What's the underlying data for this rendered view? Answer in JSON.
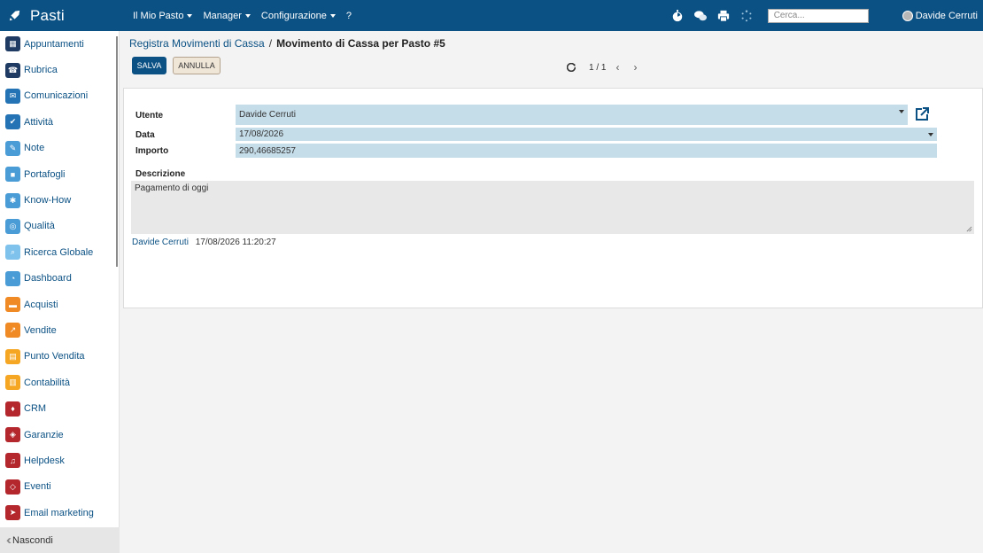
{
  "topbar": {
    "brand": "Pasti",
    "menu": [
      {
        "label": "Il Mio Pasto",
        "caret": true
      },
      {
        "label": "Manager",
        "caret": true
      },
      {
        "label": "Configurazione",
        "caret": true
      },
      {
        "label": "?",
        "caret": false
      }
    ],
    "icons": [
      "timer-icon",
      "chat-icon",
      "print-icon",
      "loading-icon"
    ],
    "search_placeholder": "Cerca...",
    "user_name": "Davide Cerruti"
  },
  "sidebar": {
    "items": [
      {
        "label": "Appuntamenti",
        "icon": "calendar-icon",
        "color": "#1f3b63"
      },
      {
        "label": "Rubrica",
        "icon": "contacts-icon",
        "color": "#1f3b63"
      },
      {
        "label": "Comunicazioni",
        "icon": "message-icon",
        "color": "#2474b5"
      },
      {
        "label": "Attività",
        "icon": "check-icon",
        "color": "#2474b5"
      },
      {
        "label": "Note",
        "icon": "note-icon",
        "color": "#4a9cd6"
      },
      {
        "label": "Portafogli",
        "icon": "lock-icon",
        "color": "#4a9cd6"
      },
      {
        "label": "Know-How",
        "icon": "brain-icon",
        "color": "#4a9cd6"
      },
      {
        "label": "Qualità",
        "icon": "quality-icon",
        "color": "#4a9cd6"
      },
      {
        "label": "Ricerca Globale",
        "icon": "search-icon",
        "color": "#7fc3ec"
      },
      {
        "label": "Dashboard",
        "icon": "dashboard-icon",
        "color": "#4a9cd6"
      },
      {
        "label": "Acquisti",
        "icon": "purchase-icon",
        "color": "#f08a24"
      },
      {
        "label": "Vendite",
        "icon": "sales-icon",
        "color": "#f08a24"
      },
      {
        "label": "Punto Vendita",
        "icon": "pos-icon",
        "color": "#f5a623"
      },
      {
        "label": "Contabilità",
        "icon": "accounting-icon",
        "color": "#f5a623"
      },
      {
        "label": "CRM",
        "icon": "handshake-icon",
        "color": "#b3272d"
      },
      {
        "label": "Garanzie",
        "icon": "shield-icon",
        "color": "#b3272d"
      },
      {
        "label": "Helpdesk",
        "icon": "headset-icon",
        "color": "#b3272d"
      },
      {
        "label": "Eventi",
        "icon": "ticket-icon",
        "color": "#b3272d"
      },
      {
        "label": "Email marketing",
        "icon": "send-icon",
        "color": "#b3272d"
      }
    ],
    "footer_label": "Nascondi"
  },
  "breadcrumb": {
    "parent": "Registra Movimenti di Cassa",
    "separator": "/",
    "current": "Movimento di Cassa per Pasto #5"
  },
  "toolbar": {
    "save_label": "SALVA",
    "cancel_label": "ANNULLA"
  },
  "pager": {
    "count": "1 / 1",
    "prev": "‹",
    "next": "›"
  },
  "form": {
    "utente_label": "Utente",
    "utente_value": "Davide Cerruti",
    "data_label": "Data",
    "data_value": "17/08/2026",
    "importo_label": "Importo",
    "importo_value": "290,46685257",
    "descrizione_label": "Descrizione",
    "descrizione_value": "Pagamento di oggi"
  },
  "footer": {
    "author": "Davide Cerruti",
    "timestamp": "17/08/2026 11:20:27"
  },
  "colors": {
    "primary": "#0b5184",
    "field_bg": "#c5dce9"
  }
}
